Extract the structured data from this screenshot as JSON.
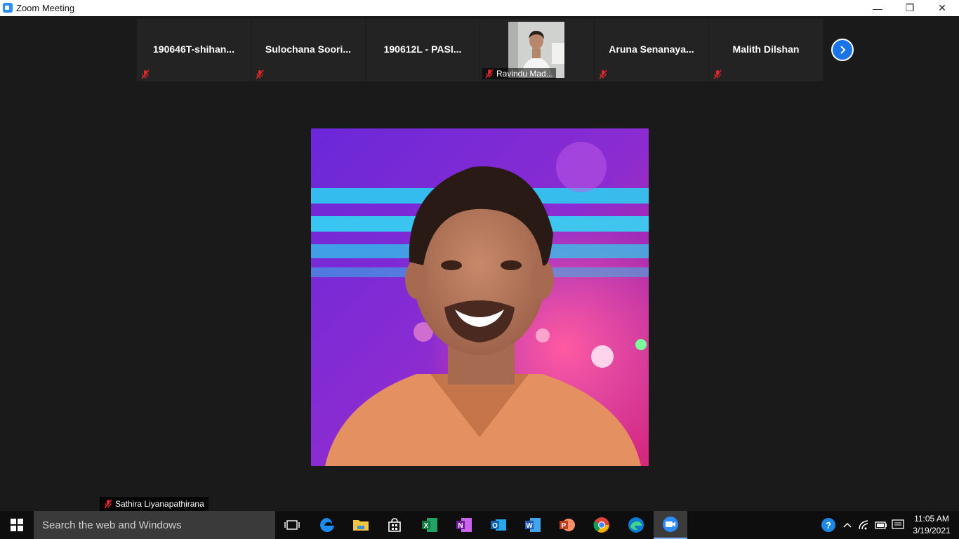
{
  "window": {
    "title": "Zoom Meeting",
    "controls": {
      "minimize": "—",
      "maximize": "❐",
      "close": "✕"
    }
  },
  "filmstrip": {
    "participants": [
      {
        "name": "190646T-shihan...",
        "muted": true,
        "video": false
      },
      {
        "name": "Sulochana  Soori...",
        "muted": true,
        "video": false
      },
      {
        "name": "190612L - PASI...",
        "muted": false,
        "video": false
      },
      {
        "name": "Ravindu Mad...",
        "muted": true,
        "video": true
      },
      {
        "name": "Aruna  Senanaya...",
        "muted": true,
        "video": false
      },
      {
        "name": "Malith Dilshan",
        "muted": true,
        "video": false
      }
    ],
    "next_icon": "chevron-right-icon"
  },
  "active_speaker": {
    "name": "Sathira Liyanapathirana",
    "muted": true
  },
  "taskbar": {
    "search_placeholder": "Search the web and Windows",
    "apps": [
      "task-view",
      "edge-legacy",
      "file-explorer",
      "store",
      "excel",
      "onenote",
      "outlook",
      "word",
      "powerpoint",
      "chrome",
      "edge",
      "zoom"
    ],
    "active_app": "zoom",
    "clock": {
      "time": "11:05 AM",
      "date": "3/19/2021"
    }
  },
  "colors": {
    "background": "#1a1a1a",
    "tile": "#232323",
    "accent": "#1a73e8",
    "muted_red": "#e02828",
    "taskbar": "#0e0e0e"
  }
}
